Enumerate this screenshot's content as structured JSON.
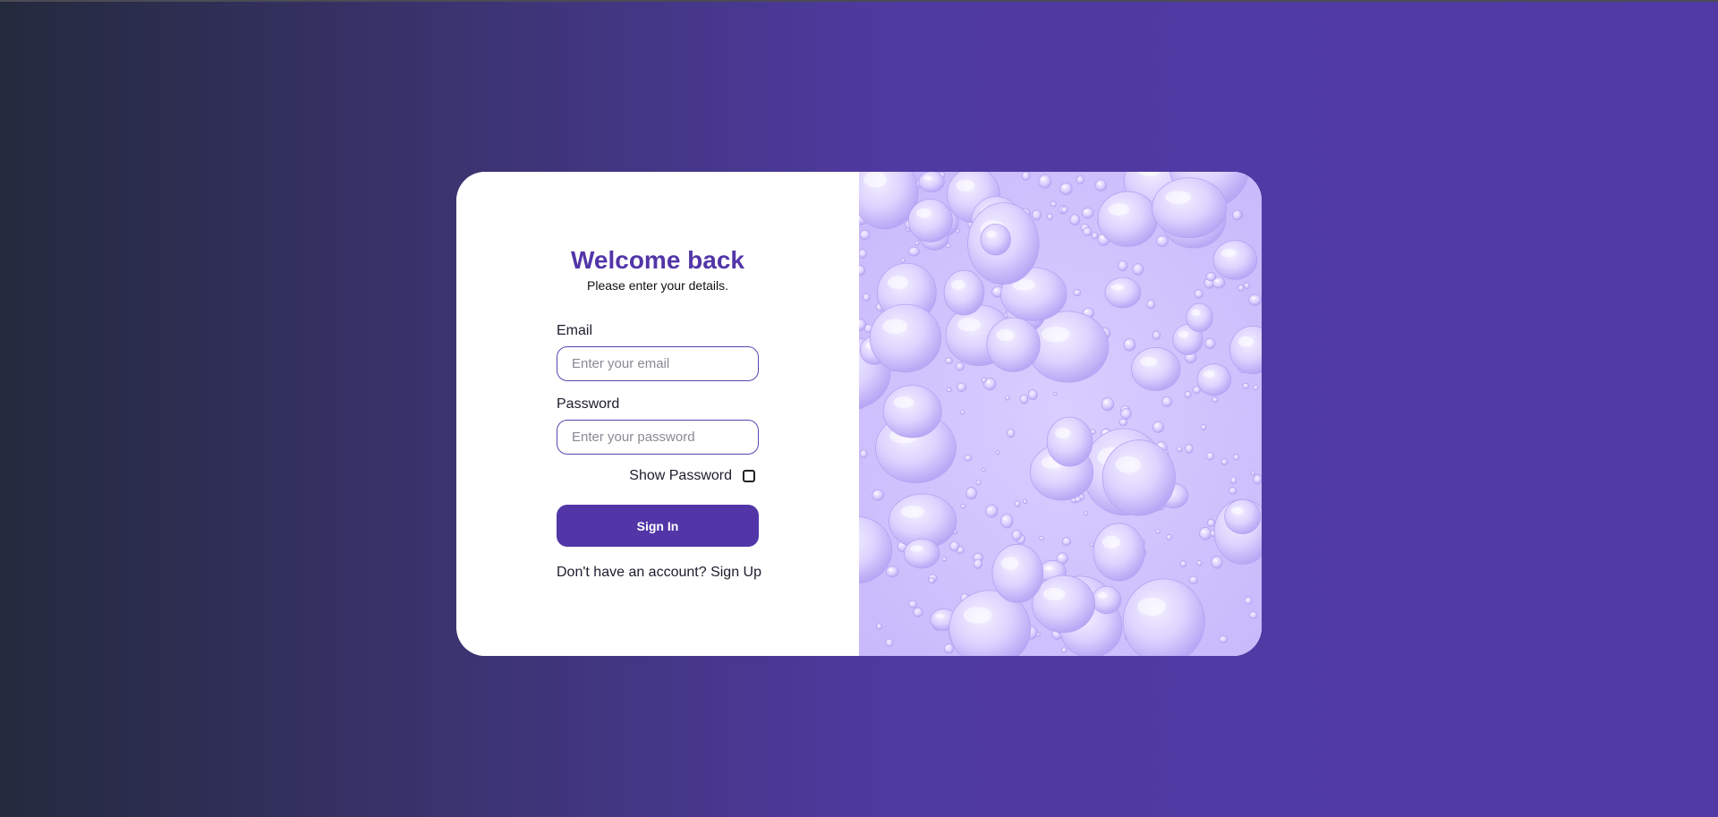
{
  "login": {
    "title": "Welcome back",
    "subtitle": "Please enter your details.",
    "email_label": "Email",
    "email_placeholder": "Enter your email",
    "email_value": "",
    "password_label": "Password",
    "password_placeholder": "Enter your password",
    "password_value": "",
    "show_password_label": "Show Password",
    "show_password_checked": false,
    "signin_label": "Sign In",
    "signup_prompt": "Don't have an account?",
    "signup_link": "Sign Up"
  },
  "colors": {
    "accent": "#5236a8",
    "background_start": "#242a3d",
    "background_end": "#523aa6",
    "image_tint": "#d4c9ff"
  },
  "icons": {
    "decorative_image": "water-droplets-image"
  }
}
